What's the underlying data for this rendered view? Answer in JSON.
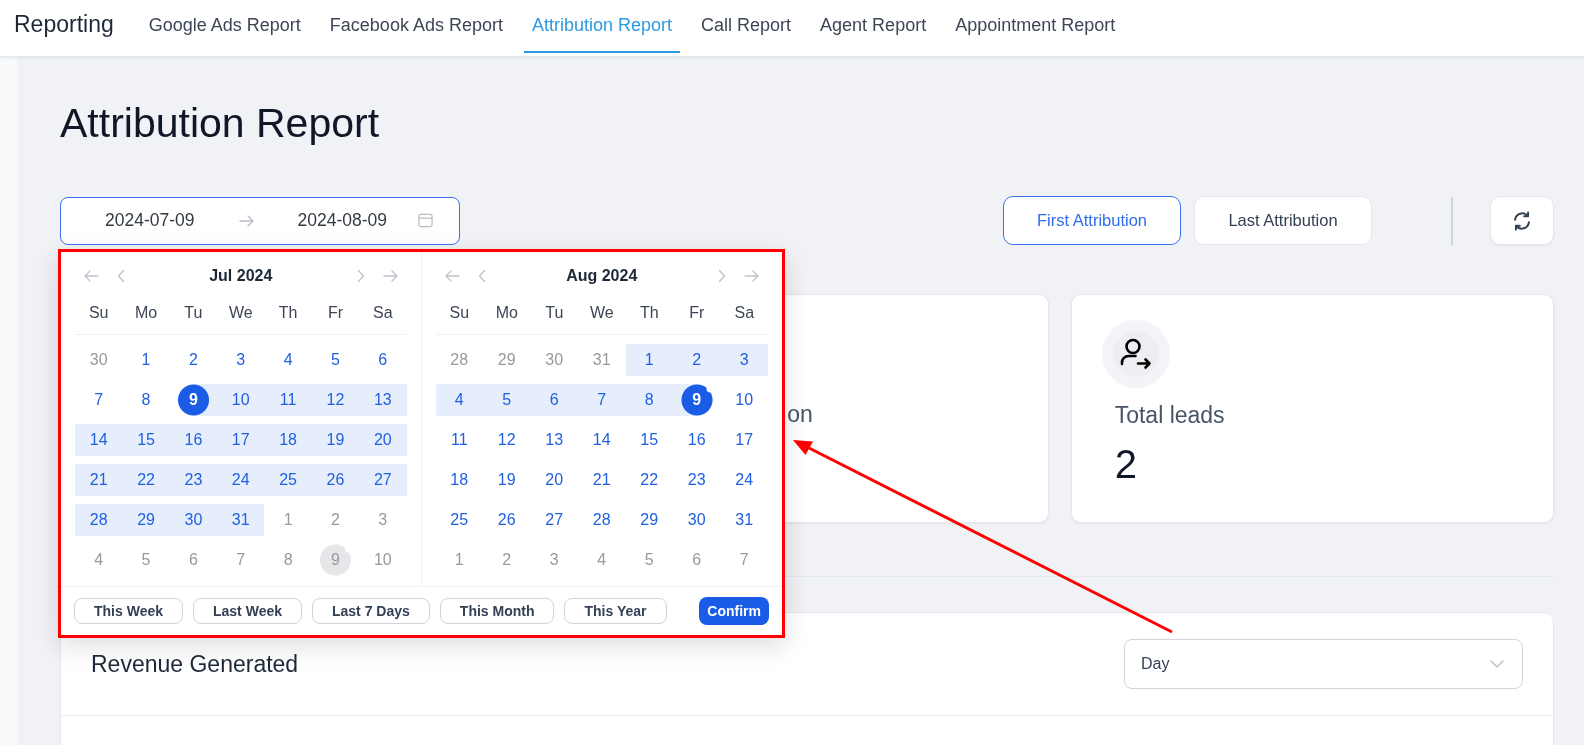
{
  "nav": {
    "brand": "Reporting",
    "tabs": [
      {
        "label": "Google Ads Report",
        "selected": false
      },
      {
        "label": "Facebook Ads Report",
        "selected": false
      },
      {
        "label": "Attribution Report",
        "selected": true
      },
      {
        "label": "Call Report",
        "selected": false
      },
      {
        "label": "Agent Report",
        "selected": false
      },
      {
        "label": "Appointment Report",
        "selected": false
      }
    ]
  },
  "page": {
    "title": "Attribution Report"
  },
  "date_range": {
    "start": "2024-07-09",
    "end": "2024-08-09"
  },
  "attribution_modes": [
    {
      "label": "First Attribution",
      "selected": true
    },
    {
      "label": "Last Attribution",
      "selected": false
    }
  ],
  "date_picker": {
    "months": [
      {
        "title": "Jul 2024",
        "weekdays": [
          "Su",
          "Mo",
          "Tu",
          "We",
          "Th",
          "Fr",
          "Sa"
        ],
        "weeks": [
          [
            {
              "label": "30",
              "outside": true,
              "in_range": false,
              "selected": false,
              "today": false
            },
            {
              "label": "1",
              "outside": false,
              "in_range": false,
              "selected": false,
              "today": false
            },
            {
              "label": "2",
              "outside": false,
              "in_range": false,
              "selected": false,
              "today": false
            },
            {
              "label": "3",
              "outside": false,
              "in_range": false,
              "selected": false,
              "today": false
            },
            {
              "label": "4",
              "outside": false,
              "in_range": false,
              "selected": false,
              "today": false
            },
            {
              "label": "5",
              "outside": false,
              "in_range": false,
              "selected": false,
              "today": false
            },
            {
              "label": "6",
              "outside": false,
              "in_range": false,
              "selected": false,
              "today": false
            }
          ],
          [
            {
              "label": "7",
              "outside": false,
              "in_range": false,
              "selected": false,
              "today": false
            },
            {
              "label": "8",
              "outside": false,
              "in_range": false,
              "selected": false,
              "today": false
            },
            {
              "label": "9",
              "outside": false,
              "in_range": false,
              "selected": true,
              "today": false
            },
            {
              "label": "10",
              "outside": false,
              "in_range": true,
              "selected": false,
              "today": false
            },
            {
              "label": "11",
              "outside": false,
              "in_range": true,
              "selected": false,
              "today": false
            },
            {
              "label": "12",
              "outside": false,
              "in_range": true,
              "selected": false,
              "today": false
            },
            {
              "label": "13",
              "outside": false,
              "in_range": true,
              "selected": false,
              "today": false
            }
          ],
          [
            {
              "label": "14",
              "outside": false,
              "in_range": true,
              "selected": false,
              "today": false
            },
            {
              "label": "15",
              "outside": false,
              "in_range": true,
              "selected": false,
              "today": false
            },
            {
              "label": "16",
              "outside": false,
              "in_range": true,
              "selected": false,
              "today": false
            },
            {
              "label": "17",
              "outside": false,
              "in_range": true,
              "selected": false,
              "today": false
            },
            {
              "label": "18",
              "outside": false,
              "in_range": true,
              "selected": false,
              "today": false
            },
            {
              "label": "19",
              "outside": false,
              "in_range": true,
              "selected": false,
              "today": false
            },
            {
              "label": "20",
              "outside": false,
              "in_range": true,
              "selected": false,
              "today": false
            }
          ],
          [
            {
              "label": "21",
              "outside": false,
              "in_range": true,
              "selected": false,
              "today": false
            },
            {
              "label": "22",
              "outside": false,
              "in_range": true,
              "selected": false,
              "today": false
            },
            {
              "label": "23",
              "outside": false,
              "in_range": true,
              "selected": false,
              "today": false
            },
            {
              "label": "24",
              "outside": false,
              "in_range": true,
              "selected": false,
              "today": false
            },
            {
              "label": "25",
              "outside": false,
              "in_range": true,
              "selected": false,
              "today": false
            },
            {
              "label": "26",
              "outside": false,
              "in_range": true,
              "selected": false,
              "today": false
            },
            {
              "label": "27",
              "outside": false,
              "in_range": true,
              "selected": false,
              "today": false
            }
          ],
          [
            {
              "label": "28",
              "outside": false,
              "in_range": true,
              "selected": false,
              "today": false
            },
            {
              "label": "29",
              "outside": false,
              "in_range": true,
              "selected": false,
              "today": false
            },
            {
              "label": "30",
              "outside": false,
              "in_range": true,
              "selected": false,
              "today": false
            },
            {
              "label": "31",
              "outside": false,
              "in_range": true,
              "selected": false,
              "today": false
            },
            {
              "label": "1",
              "outside": true,
              "in_range": false,
              "selected": false,
              "today": false
            },
            {
              "label": "2",
              "outside": true,
              "in_range": false,
              "selected": false,
              "today": false
            },
            {
              "label": "3",
              "outside": true,
              "in_range": false,
              "selected": false,
              "today": false
            }
          ],
          [
            {
              "label": "4",
              "outside": true,
              "in_range": false,
              "selected": false,
              "today": false
            },
            {
              "label": "5",
              "outside": true,
              "in_range": false,
              "selected": false,
              "today": false
            },
            {
              "label": "6",
              "outside": true,
              "in_range": false,
              "selected": false,
              "today": false
            },
            {
              "label": "7",
              "outside": true,
              "in_range": false,
              "selected": false,
              "today": false
            },
            {
              "label": "8",
              "outside": true,
              "in_range": false,
              "selected": false,
              "today": false
            },
            {
              "label": "9",
              "outside": true,
              "in_range": false,
              "selected": false,
              "today": true
            },
            {
              "label": "10",
              "outside": true,
              "in_range": false,
              "selected": false,
              "today": false
            }
          ]
        ]
      },
      {
        "title": "Aug 2024",
        "weekdays": [
          "Su",
          "Mo",
          "Tu",
          "We",
          "Th",
          "Fr",
          "Sa"
        ],
        "weeks": [
          [
            {
              "label": "28",
              "outside": true,
              "in_range": false,
              "selected": false,
              "today": false
            },
            {
              "label": "29",
              "outside": true,
              "in_range": false,
              "selected": false,
              "today": false
            },
            {
              "label": "30",
              "outside": true,
              "in_range": false,
              "selected": false,
              "today": false
            },
            {
              "label": "31",
              "outside": true,
              "in_range": false,
              "selected": false,
              "today": false
            },
            {
              "label": "1",
              "outside": false,
              "in_range": true,
              "selected": false,
              "today": false
            },
            {
              "label": "2",
              "outside": false,
              "in_range": true,
              "selected": false,
              "today": false
            },
            {
              "label": "3",
              "outside": false,
              "in_range": true,
              "selected": false,
              "today": false
            }
          ],
          [
            {
              "label": "4",
              "outside": false,
              "in_range": true,
              "selected": false,
              "today": false
            },
            {
              "label": "5",
              "outside": false,
              "in_range": true,
              "selected": false,
              "today": false
            },
            {
              "label": "6",
              "outside": false,
              "in_range": true,
              "selected": false,
              "today": false
            },
            {
              "label": "7",
              "outside": false,
              "in_range": true,
              "selected": false,
              "today": false
            },
            {
              "label": "8",
              "outside": false,
              "in_range": true,
              "selected": false,
              "today": false
            },
            {
              "label": "9",
              "outside": false,
              "in_range": false,
              "selected": true,
              "today": true
            },
            {
              "label": "10",
              "outside": false,
              "in_range": false,
              "selected": false,
              "today": false
            }
          ],
          [
            {
              "label": "11",
              "outside": false,
              "in_range": false,
              "selected": false,
              "today": false
            },
            {
              "label": "12",
              "outside": false,
              "in_range": false,
              "selected": false,
              "today": false
            },
            {
              "label": "13",
              "outside": false,
              "in_range": false,
              "selected": false,
              "today": false
            },
            {
              "label": "14",
              "outside": false,
              "in_range": false,
              "selected": false,
              "today": false
            },
            {
              "label": "15",
              "outside": false,
              "in_range": false,
              "selected": false,
              "today": false
            },
            {
              "label": "16",
              "outside": false,
              "in_range": false,
              "selected": false,
              "today": false
            },
            {
              "label": "17",
              "outside": false,
              "in_range": false,
              "selected": false,
              "today": false
            }
          ],
          [
            {
              "label": "18",
              "outside": false,
              "in_range": false,
              "selected": false,
              "today": false
            },
            {
              "label": "19",
              "outside": false,
              "in_range": false,
              "selected": false,
              "today": false
            },
            {
              "label": "20",
              "outside": false,
              "in_range": false,
              "selected": false,
              "today": false
            },
            {
              "label": "21",
              "outside": false,
              "in_range": false,
              "selected": false,
              "today": false
            },
            {
              "label": "22",
              "outside": false,
              "in_range": false,
              "selected": false,
              "today": false
            },
            {
              "label": "23",
              "outside": false,
              "in_range": false,
              "selected": false,
              "today": false
            },
            {
              "label": "24",
              "outside": false,
              "in_range": false,
              "selected": false,
              "today": false
            }
          ],
          [
            {
              "label": "25",
              "outside": false,
              "in_range": false,
              "selected": false,
              "today": false
            },
            {
              "label": "26",
              "outside": false,
              "in_range": false,
              "selected": false,
              "today": false
            },
            {
              "label": "27",
              "outside": false,
              "in_range": false,
              "selected": false,
              "today": false
            },
            {
              "label": "28",
              "outside": false,
              "in_range": false,
              "selected": false,
              "today": false
            },
            {
              "label": "29",
              "outside": false,
              "in_range": false,
              "selected": false,
              "today": false
            },
            {
              "label": "30",
              "outside": false,
              "in_range": false,
              "selected": false,
              "today": false
            },
            {
              "label": "31",
              "outside": false,
              "in_range": false,
              "selected": false,
              "today": false
            }
          ],
          [
            {
              "label": "1",
              "outside": true,
              "in_range": false,
              "selected": false,
              "today": false
            },
            {
              "label": "2",
              "outside": true,
              "in_range": false,
              "selected": false,
              "today": false
            },
            {
              "label": "3",
              "outside": true,
              "in_range": false,
              "selected": false,
              "today": false
            },
            {
              "label": "4",
              "outside": true,
              "in_range": false,
              "selected": false,
              "today": false
            },
            {
              "label": "5",
              "outside": true,
              "in_range": false,
              "selected": false,
              "today": false
            },
            {
              "label": "6",
              "outside": true,
              "in_range": false,
              "selected": false,
              "today": false
            },
            {
              "label": "7",
              "outside": true,
              "in_range": false,
              "selected": false,
              "today": false
            }
          ]
        ]
      }
    ],
    "presets": [
      "This Week",
      "Last Week",
      "Last 7 Days",
      "This Month",
      "This Year"
    ],
    "confirm": "Confirm"
  },
  "cards": [
    {
      "kind": "partial",
      "label": "on"
    },
    {
      "kind": "metric",
      "label": "Total leads",
      "value": "2"
    }
  ],
  "revenue": {
    "title": "Revenue Generated",
    "period": {
      "value": "Day"
    }
  }
}
